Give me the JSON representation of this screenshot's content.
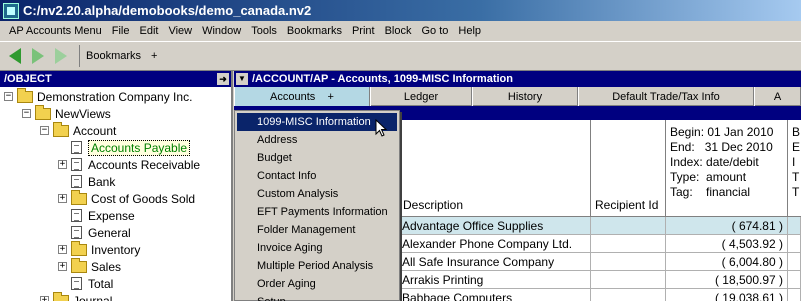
{
  "window": {
    "title": "C:/nv2.20.alpha/demobooks/demo_canada.nv2"
  },
  "menu": [
    "AP Accounts Menu",
    "File",
    "Edit",
    "View",
    "Window",
    "Tools",
    "Bookmarks",
    "Print",
    "Block",
    "Go to",
    "Help"
  ],
  "toolbar": {
    "bookmarks_label": "Bookmarks",
    "bookmarks_plus": "+"
  },
  "left": {
    "header": "/OBJECT",
    "go_icon": "➜",
    "tree": [
      {
        "label": "Demonstration Company Inc.",
        "type": "folder",
        "expander": "−"
      },
      {
        "label": "NewViews",
        "type": "folder",
        "expander": "−"
      },
      {
        "label": "Account",
        "type": "folder",
        "expander": "−"
      },
      {
        "label": "Accounts Payable",
        "type": "doc",
        "expander": "",
        "selected": true
      },
      {
        "label": "Accounts Receivable",
        "type": "doc",
        "expander": "+"
      },
      {
        "label": "Bank",
        "type": "doc",
        "expander": ""
      },
      {
        "label": "Cost of Goods Sold",
        "type": "folder",
        "expander": "+"
      },
      {
        "label": "Expense",
        "type": "doc",
        "expander": ""
      },
      {
        "label": "General",
        "type": "doc",
        "expander": ""
      },
      {
        "label": "Inventory",
        "type": "folder",
        "expander": "+"
      },
      {
        "label": "Sales",
        "type": "folder",
        "expander": "+"
      },
      {
        "label": "Total",
        "type": "doc",
        "expander": ""
      },
      {
        "label": "Journal",
        "type": "folder",
        "expander": "+"
      }
    ]
  },
  "right": {
    "header": "/ACCOUNT/AP - Accounts, 1099-MISC Information",
    "dropbtn": "▼",
    "tabs": [
      {
        "label": "Accounts    +",
        "active": true
      },
      {
        "label": "Ledger"
      },
      {
        "label": "History"
      },
      {
        "label": "Default Trade/Tax Info"
      },
      {
        "label": "A"
      }
    ],
    "columns": {
      "description": "Description",
      "recipient": "Recipient Id",
      "period": "Begin: 01 Jan 2010\nEnd:   31 Dec 2010\nIndex: date/debit\nType:  amount\nTag:    financial",
      "next_period": "B\nE\nI\nT\nT"
    },
    "rows": [
      {
        "description": "Advantage Office Supplies",
        "recipient": "",
        "amount": "( 674.81 )",
        "selected": true
      },
      {
        "description": "Alexander Phone Company Ltd.",
        "recipient": "",
        "amount": "( 4,503.92 )"
      },
      {
        "description": "All Safe Insurance Company",
        "recipient": "",
        "amount": "( 6,004.80 )"
      },
      {
        "description": "Arrakis Printing",
        "recipient": "",
        "amount": "( 18,500.97 )"
      },
      {
        "description": "Babbage Computers",
        "recipient": "",
        "amount": "( 19,038.61 )"
      }
    ],
    "dropdown": [
      "1099-MISC Information",
      "Address",
      "Budget",
      "Contact Info",
      "Custom Analysis",
      "EFT Payments Information",
      "Folder Management",
      "Invoice Aging",
      "Multiple Period Analysis",
      "Order Aging",
      "Setup"
    ]
  },
  "colors": {
    "title_start": "#0a246a",
    "header_blue": "#000080",
    "selected_row": "#cfe6ec"
  }
}
